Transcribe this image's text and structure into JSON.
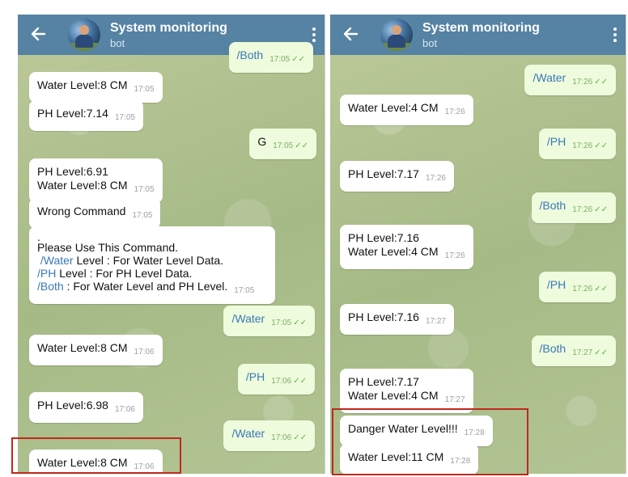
{
  "left": {
    "title": "System monitoring",
    "subtitle": "bot",
    "messages": [
      {
        "text": "/Both",
        "time": "17:05"
      },
      {
        "text": "Water Level:8 CM",
        "time": "17:05"
      },
      {
        "text": "PH Level:7.14",
        "time": "17:05"
      },
      {
        "text": "G",
        "time": "17:05"
      },
      {
        "line1": "PH Level:6.91",
        "line2": "Water Level:8 CM",
        "time": "17:05"
      },
      {
        "text": "Wrong Command",
        "time": "17:05"
      },
      {
        "dot": ".",
        "line1": "Please Use This Command.",
        "line2_cmd": "/Water",
        "line2_rest": " Level : For Water Level Data.",
        "line3_cmd": "/PH",
        "line3_rest": " Level : For PH Level Data.",
        "line4_cmd": "/Both",
        "line4_rest": " : For Water Level and PH Level.",
        "time": "17:05"
      },
      {
        "text": "/Water",
        "time": "17:05"
      },
      {
        "text": "Water Level:8 CM",
        "time": "17:06"
      },
      {
        "text": "/PH",
        "time": "17:06"
      },
      {
        "text": "PH Level:6.98",
        "time": "17:06"
      },
      {
        "text": "/Water",
        "time": "17:06"
      },
      {
        "text": "Water Level:8 CM",
        "time": "17:06"
      }
    ]
  },
  "right": {
    "title": "System monitoring",
    "subtitle": "bot",
    "messages": [
      {
        "text": "/Water",
        "time": "17:26"
      },
      {
        "text": "Water Level:4 CM",
        "time": "17:26"
      },
      {
        "text": "/PH",
        "time": "17:26"
      },
      {
        "text": "PH Level:7.17",
        "time": "17:26"
      },
      {
        "text": "/Both",
        "time": "17:26"
      },
      {
        "line1": "PH Level:7.16",
        "line2": "Water Level:4 CM",
        "time": "17:26"
      },
      {
        "text": "/PH",
        "time": "17:26"
      },
      {
        "text": "PH Level:7.16",
        "time": "17:27"
      },
      {
        "text": "/Both",
        "time": "17:27"
      },
      {
        "line1": "PH Level:7.17",
        "line2": "Water Level:4 CM",
        "time": "17:27"
      },
      {
        "text": "Danger Water Level!!!",
        "time": "17:28"
      },
      {
        "text": "Water Level:11 CM",
        "time": "17:28"
      }
    ]
  },
  "colors": {
    "header": "#5682a3",
    "incoming_bubble": "#ffffff",
    "outgoing_bubble": "#eefbdc",
    "command_text": "#3a78b8",
    "highlight_border": "#c0281c"
  },
  "icons": [
    "back-arrow-icon",
    "bot-avatar",
    "overflow-menu-icon",
    "double-check-icon"
  ]
}
